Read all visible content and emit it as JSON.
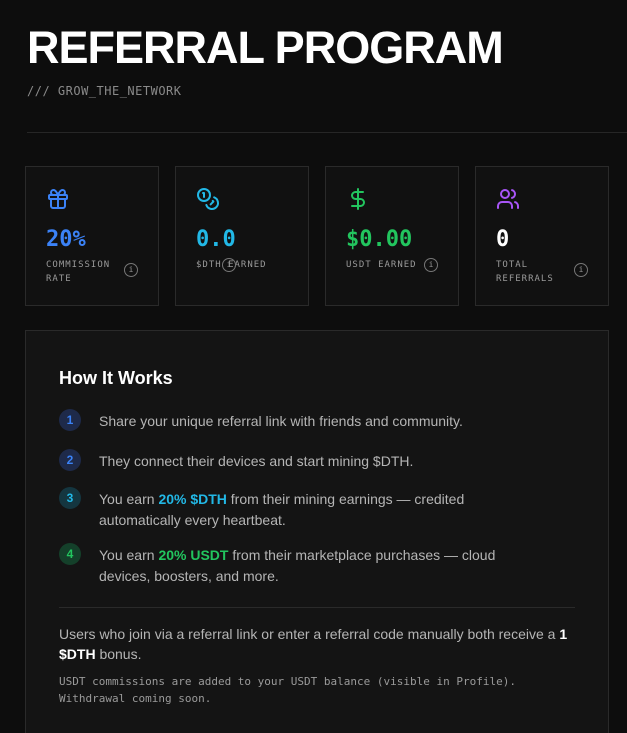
{
  "header": {
    "title": "REFERRAL PROGRAM",
    "subtitle": "/// GROW_THE_NETWORK"
  },
  "stats": [
    {
      "icon": "gift-icon",
      "value": "20%",
      "label": "COMMISSION RATE",
      "color": "#3b82f6"
    },
    {
      "icon": "coins-icon",
      "value": "0.0",
      "label": "$DTH EARNED",
      "color": "#22b8e6"
    },
    {
      "icon": "dollar-icon",
      "value": "$0.00",
      "label": "USDT EARNED",
      "color": "#22c55e"
    },
    {
      "icon": "users-icon",
      "value": "0",
      "label": "TOTAL REFERRALS",
      "color": "#ffffff"
    }
  ],
  "how_it_works": {
    "title": "How It Works",
    "steps": [
      {
        "num": "1",
        "text": "Share your unique referral link with friends and community."
      },
      {
        "num": "2",
        "text": "They connect their devices and start mining $DTH."
      },
      {
        "num": "3",
        "pre": "You earn ",
        "highlight": "20% $DTH",
        "post": " from their mining earnings — credited automatically every heartbeat."
      },
      {
        "num": "4",
        "pre": "You earn ",
        "highlight": "20% USDT",
        "post": " from their marketplace purchases — cloud devices, boosters, and more."
      }
    ],
    "bonus_pre": "Users who join via a referral link or enter a referral code manually both receive a ",
    "bonus_highlight": "1 $DTH",
    "bonus_post": " bonus.",
    "usdt_note": "USDT commissions are added to your USDT balance (visible in Profile). Withdrawal coming soon."
  },
  "colors": {
    "blue": "#3b82f6",
    "cyan": "#22b8e6",
    "green": "#22c55e",
    "purple": "#a855f7"
  }
}
